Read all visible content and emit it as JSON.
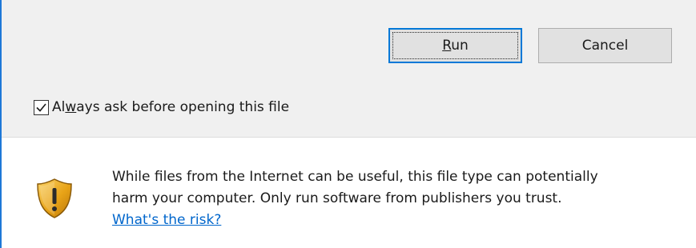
{
  "buttons": {
    "run_label_underlined": "R",
    "run_label_rest": "un",
    "cancel_label": "Cancel"
  },
  "checkbox": {
    "checked": true,
    "label_pre": "Al",
    "label_underlined": "w",
    "label_post": "ays ask before opening this file"
  },
  "warning": {
    "line1": "While files from the Internet can be useful, this file type can potentially",
    "line2": "harm your computer. Only run software from publishers you trust.",
    "link_label": "What's the risk?"
  },
  "icons": {
    "checkbox": "checkmark-icon",
    "warning": "warning-shield-icon"
  },
  "colors": {
    "accent": "#0078d7",
    "link": "#0066cc",
    "panel_bg": "#f0f0f0",
    "shield_gold": "#e8a317"
  }
}
